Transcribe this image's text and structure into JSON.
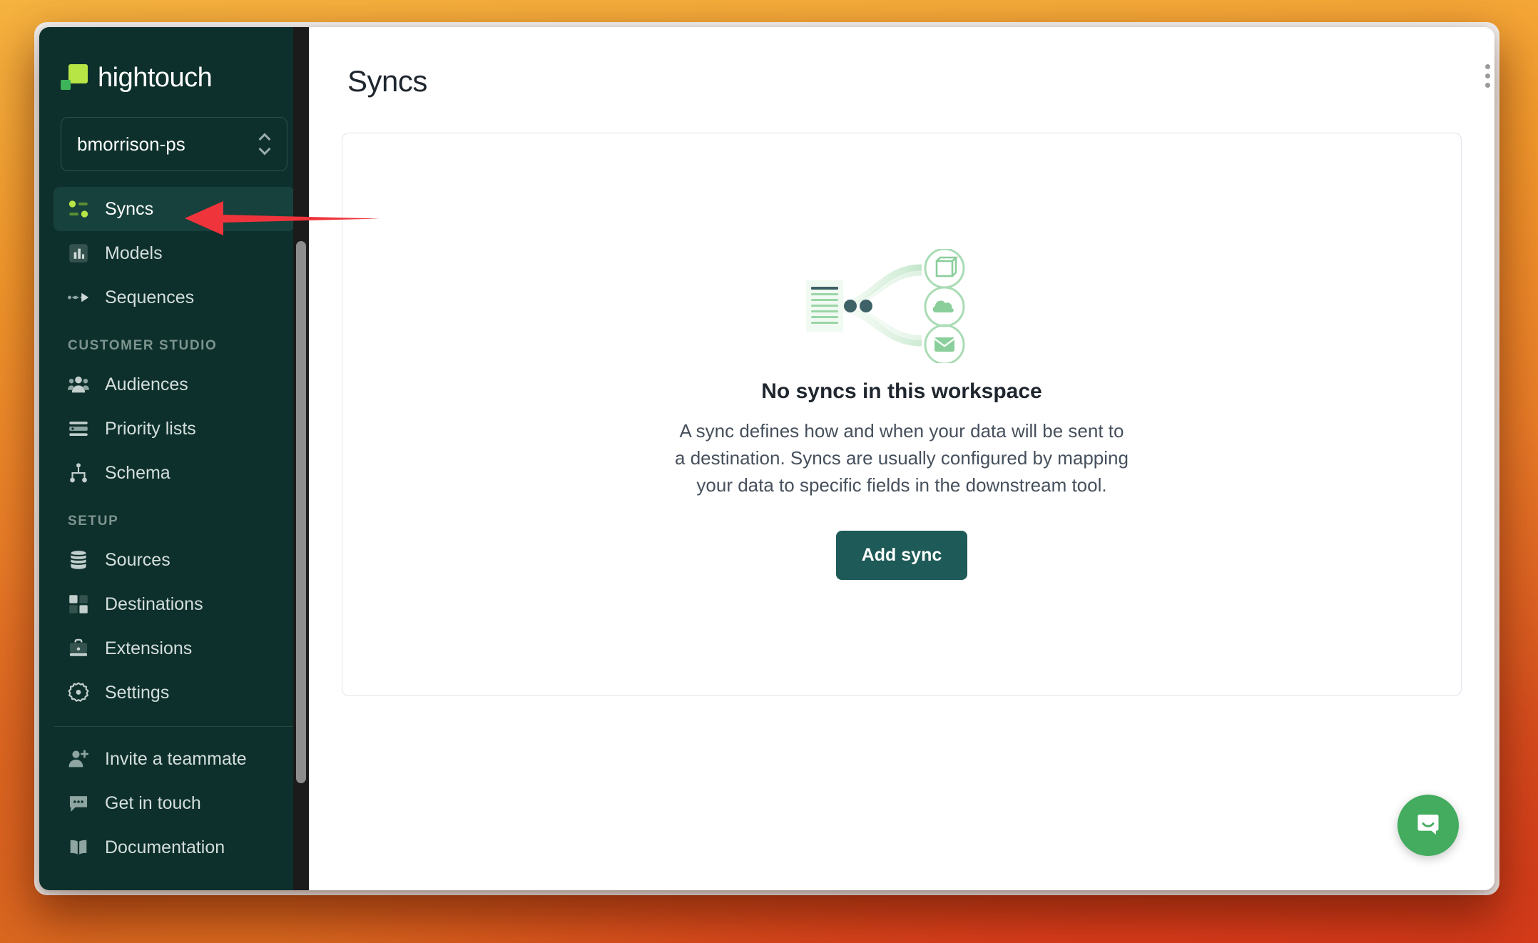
{
  "brand": {
    "name": "hightouch",
    "logo_icon": "hightouch-logo-icon",
    "accent_green": "#b7e546",
    "accent_green_dark": "#3db35a",
    "sidebar_bg": "#0d302c",
    "button_teal": "#1e5a57"
  },
  "workspace": {
    "name": "bmorrison-ps",
    "selector_icon": "chevron-up-down-icon"
  },
  "sidebar": {
    "primary_items": [
      {
        "label": "Syncs",
        "icon": "syncs-icon",
        "active": true
      },
      {
        "label": "Models",
        "icon": "models-icon",
        "active": false
      },
      {
        "label": "Sequences",
        "icon": "sequences-icon",
        "active": false
      }
    ],
    "sections": [
      {
        "title": "CUSTOMER STUDIO",
        "items": [
          {
            "label": "Audiences",
            "icon": "audiences-icon"
          },
          {
            "label": "Priority lists",
            "icon": "priority-lists-icon"
          },
          {
            "label": "Schema",
            "icon": "schema-icon"
          }
        ]
      },
      {
        "title": "SETUP",
        "items": [
          {
            "label": "Sources",
            "icon": "sources-database-icon"
          },
          {
            "label": "Destinations",
            "icon": "destinations-grid-icon"
          },
          {
            "label": "Extensions",
            "icon": "extensions-briefcase-icon"
          },
          {
            "label": "Settings",
            "icon": "settings-gear-icon"
          }
        ]
      }
    ],
    "footer_items": [
      {
        "label": "Invite a teammate",
        "icon": "user-plus-icon"
      },
      {
        "label": "Get in touch",
        "icon": "chat-bubble-icon"
      },
      {
        "label": "Documentation",
        "icon": "book-icon"
      }
    ]
  },
  "main": {
    "page_title": "Syncs",
    "empty_state": {
      "illustration_icon": "sync-flow-illustration",
      "illustration_targets": [
        "cube-icon",
        "cloud-icon",
        "envelope-icon"
      ],
      "title": "No syncs in this workspace",
      "description": "A sync defines how and when your data will be sent to a destination. Syncs are usually configured by mapping your data to specific fields in the downstream tool.",
      "cta_label": "Add sync"
    }
  },
  "support": {
    "launcher_icon": "intercom-chat-icon",
    "launcher_color": "#43ac5e"
  },
  "annotation": {
    "arrow_icon": "red-arrow-left-icon",
    "arrow_color": "#f0343c",
    "points_to": "Syncs"
  }
}
